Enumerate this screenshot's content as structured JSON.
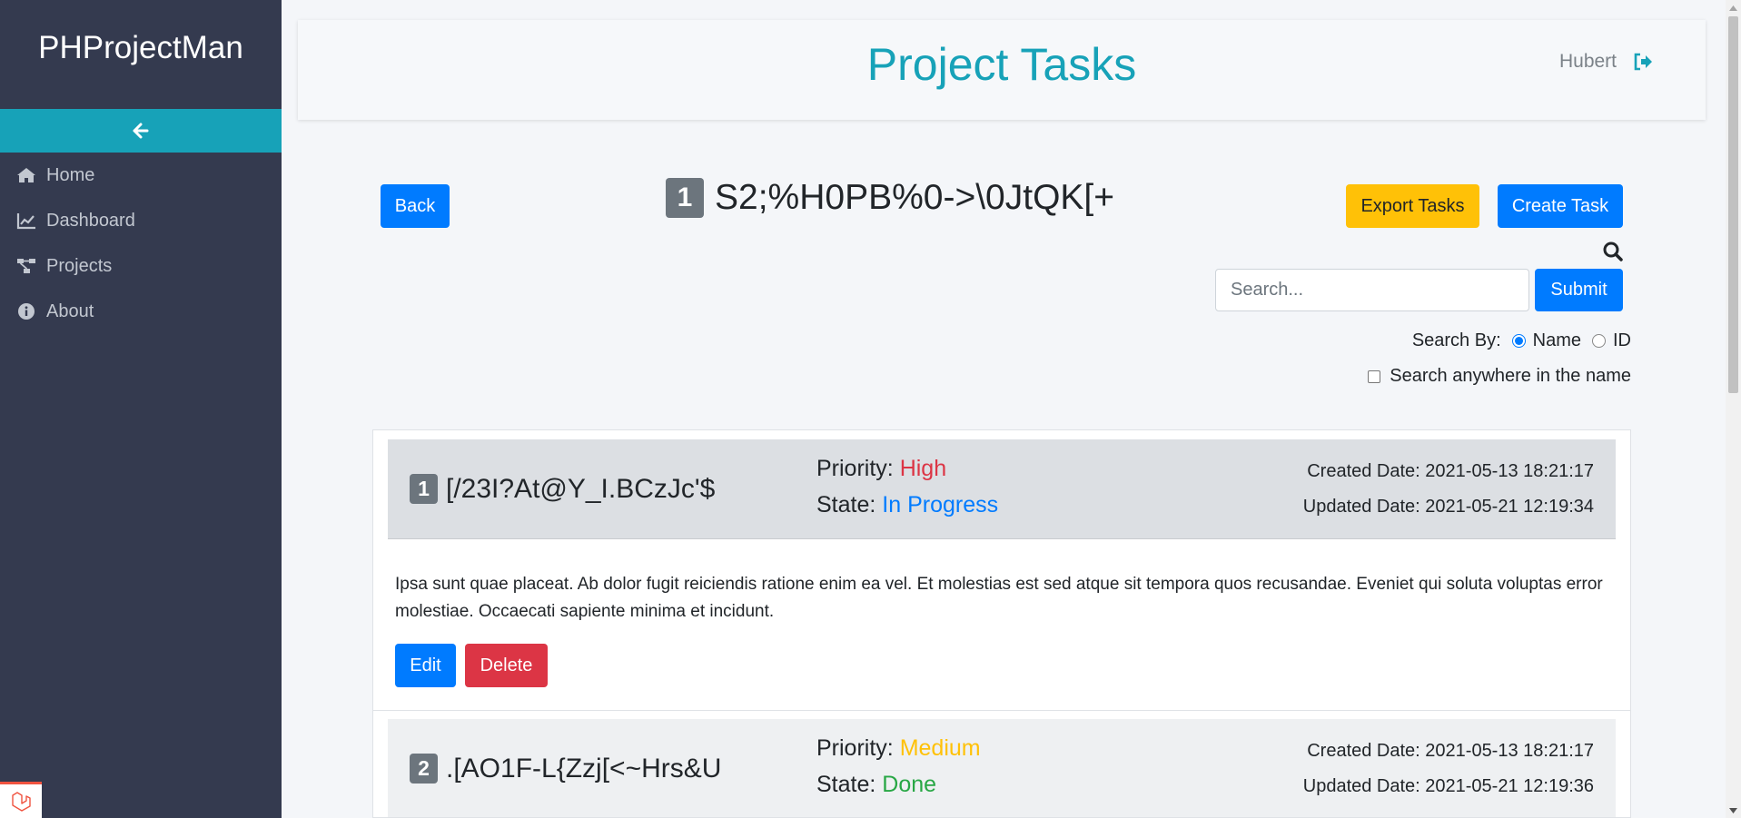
{
  "app": {
    "brand": "PHProjectMan"
  },
  "sidebar": {
    "items": [
      {
        "label": "Home",
        "icon": "home-icon"
      },
      {
        "label": "Dashboard",
        "icon": "chart-line-icon"
      },
      {
        "label": "Projects",
        "icon": "project-diagram-icon"
      },
      {
        "label": "About",
        "icon": "info-circle-icon"
      }
    ]
  },
  "header": {
    "title": "Project Tasks",
    "user": "Hubert"
  },
  "project": {
    "id": "1",
    "name": "S2;%H0PB%0->\\0JtQK[+"
  },
  "toolbar": {
    "back_label": "Back",
    "export_label": "Export Tasks",
    "create_label": "Create Task"
  },
  "search": {
    "placeholder": "Search...",
    "submit_label": "Submit",
    "by_label": "Search By:",
    "option_name": "Name",
    "option_id": "ID",
    "selected": "Name",
    "anywhere_label": "Search anywhere in the name",
    "anywhere_checked": false
  },
  "tasks": [
    {
      "id": "1",
      "name": "[/23I?At@Y_I.BCzJc'$",
      "priority_label": "Priority:",
      "priority": "High",
      "state_label": "State:",
      "state": "In Progress",
      "created": "Created Date: 2021-05-13 18:21:17",
      "updated": "Updated Date: 2021-05-21 12:19:34",
      "description": "Ipsa sunt quae placeat. Ab dolor fugit reiciendis ratione enim ea vel. Et molestias est sed atque sit tempora quos recusandae. Eveniet qui soluta voluptas error molestiae. Occaecati sapiente minima et incidunt.",
      "edit_label": "Edit",
      "delete_label": "Delete"
    },
    {
      "id": "2",
      "name": ".[AO1F-L{Zzj[<~Hrs&U",
      "priority_label": "Priority:",
      "priority": "Medium",
      "state_label": "State:",
      "state": "Done",
      "created": "Created Date: 2021-05-13 18:21:17",
      "updated": "Updated Date: 2021-05-21 12:19:36"
    }
  ],
  "colors": {
    "sidebar_bg": "#343a4f",
    "accent": "#17a2b8",
    "primary": "#007bff",
    "warning": "#ffc107",
    "danger": "#dc3545",
    "success": "#28a745"
  }
}
